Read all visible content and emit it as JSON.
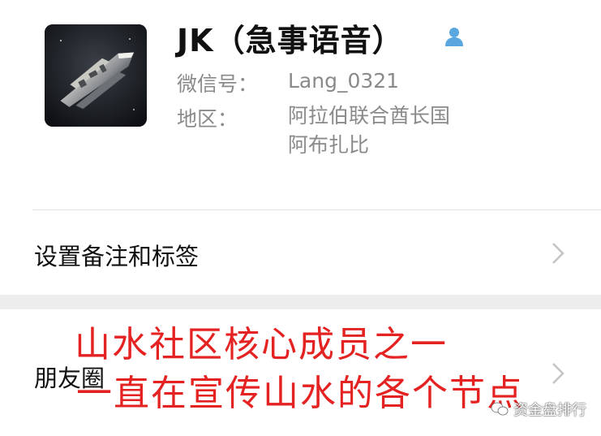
{
  "profile": {
    "name": "JK（急事语音）",
    "wechat_id_label": "微信号：",
    "wechat_id_value": "Lang_0321",
    "region_label": "地区：",
    "region_line1": "阿拉伯联合酋长国",
    "region_line2": "阿布扎比",
    "gender_icon": "person-icon",
    "gender_icon_color": "#5aa7e0"
  },
  "rows": {
    "remark_label": "设置备注和标签",
    "moments_label": "朋友圈"
  },
  "overlay": {
    "line1": "山水社区核心成员之一",
    "line2": "一直在宣传山水的各个节点",
    "color": "#e52222"
  },
  "watermark": {
    "text": "资金盘排行",
    "icon": "wechat-logo-icon"
  }
}
